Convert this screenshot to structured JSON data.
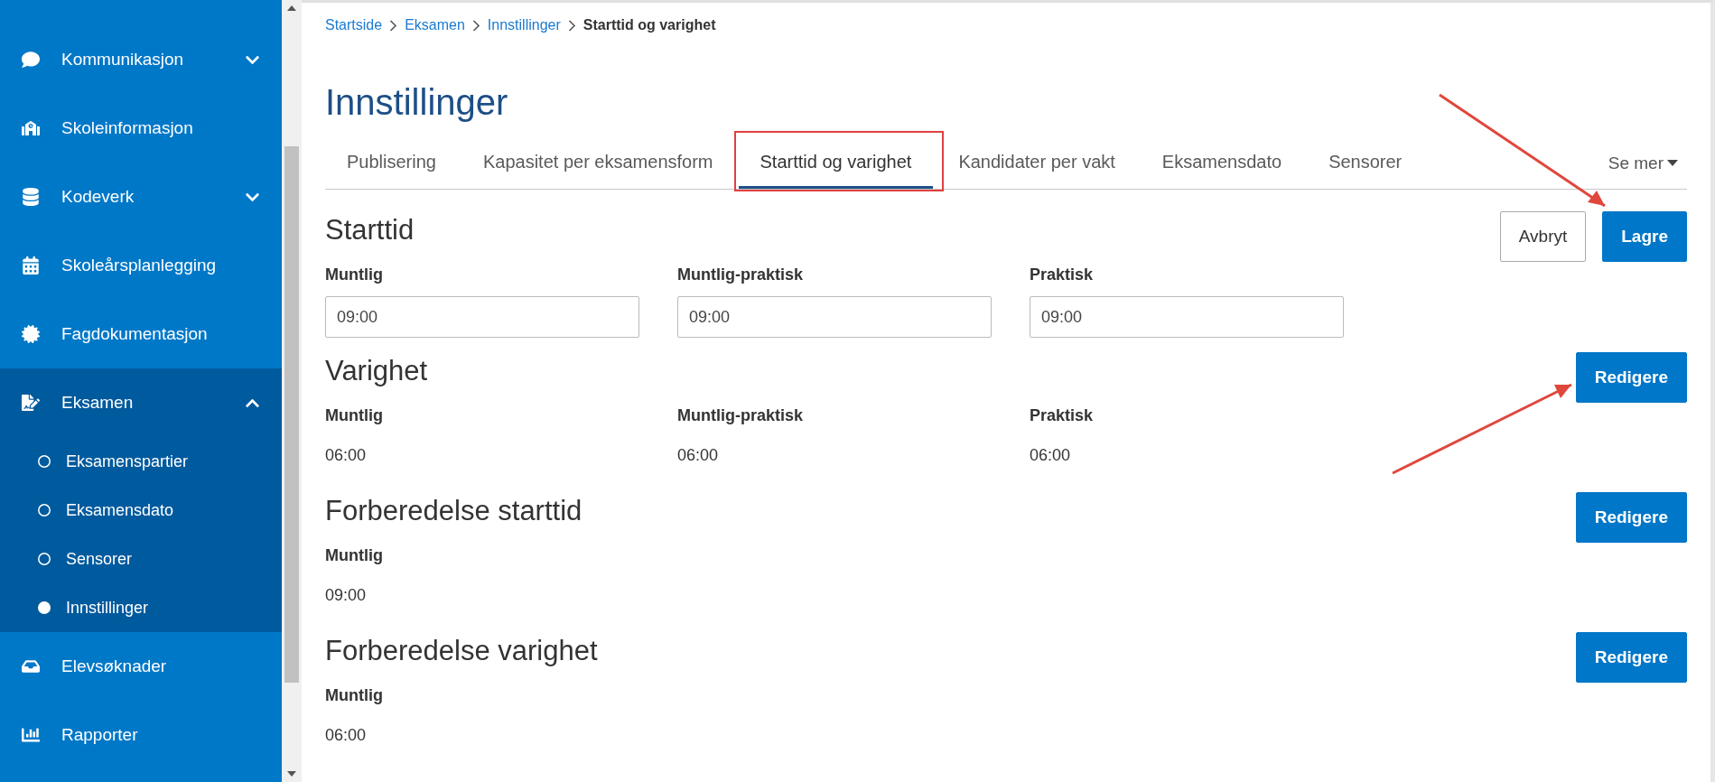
{
  "sidebar": {
    "items": [
      {
        "label": "Kommunikasjon",
        "expanded": false
      },
      {
        "label": "Skoleinformasjon"
      },
      {
        "label": "Kodeverk",
        "expanded": false
      },
      {
        "label": "Skoleårsplanlegging"
      },
      {
        "label": "Fagdokumentasjon"
      },
      {
        "label": "Eksamen",
        "expanded": true,
        "children": [
          {
            "label": "Eksamenspartier",
            "selected": false
          },
          {
            "label": "Eksamensdato",
            "selected": false
          },
          {
            "label": "Sensorer",
            "selected": false
          },
          {
            "label": "Innstillinger",
            "selected": true
          }
        ]
      },
      {
        "label": "Elevsøknader"
      },
      {
        "label": "Rapporter"
      }
    ]
  },
  "breadcrumb": [
    "Startside",
    "Eksamen",
    "Innstillinger",
    "Starttid og varighet"
  ],
  "title": "Innstillinger",
  "tabs": [
    {
      "label": "Publisering",
      "selected": false
    },
    {
      "label": "Kapasitet per eksamensform",
      "selected": false
    },
    {
      "label": "Starttid og varighet",
      "selected": true
    },
    {
      "label": "Kandidater per vakt",
      "selected": false
    },
    {
      "label": "Eksamensdato",
      "selected": false
    },
    {
      "label": "Sensorer",
      "selected": false
    }
  ],
  "more_menu": "Se mer",
  "sections": [
    {
      "title": "Starttid",
      "kind": "form",
      "buttons": [
        {
          "label": "Avbryt",
          "kind": "secondary"
        },
        {
          "label": "Lagre",
          "kind": "primary"
        }
      ],
      "fields": [
        {
          "label": "Muntlig",
          "value": "09:00"
        },
        {
          "label": "Muntlig-praktisk",
          "value": "09:00"
        },
        {
          "label": "Praktisk",
          "value": "09:00"
        }
      ]
    },
    {
      "title": "Varighet",
      "kind": "view",
      "buttons": [
        {
          "label": "Redigere",
          "kind": "primary"
        }
      ],
      "fields": [
        {
          "label": "Muntlig",
          "value": "06:00"
        },
        {
          "label": "Muntlig-praktisk",
          "value": "06:00"
        },
        {
          "label": "Praktisk",
          "value": "06:00"
        }
      ]
    },
    {
      "title": "Forberedelse starttid",
      "kind": "view",
      "buttons": [
        {
          "label": "Redigere",
          "kind": "primary"
        }
      ],
      "fields": [
        {
          "label": "Muntlig",
          "value": "09:00"
        }
      ]
    },
    {
      "title": "Forberedelse varighet",
      "kind": "view",
      "buttons": [
        {
          "label": "Redigere",
          "kind": "primary"
        }
      ],
      "fields": [
        {
          "label": "Muntlig",
          "value": "06:00"
        }
      ]
    }
  ]
}
